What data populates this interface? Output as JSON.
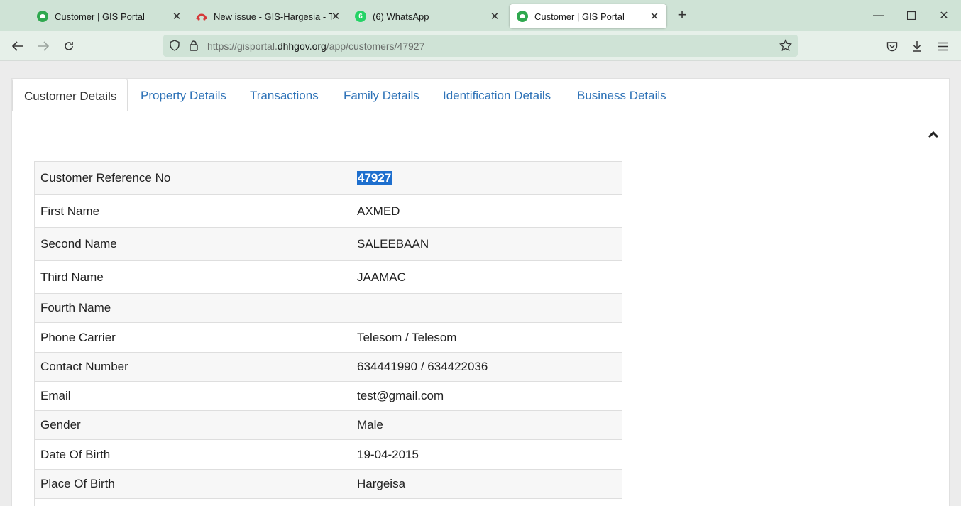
{
  "browser": {
    "tabs": [
      {
        "title": "Customer | GIS Portal",
        "icon": "gis-portal-icon"
      },
      {
        "title": "New issue - GIS-Hargesia - Team",
        "icon": "team-icon"
      },
      {
        "title": "(6) WhatsApp",
        "icon": "whatsapp-icon",
        "badge": "6"
      },
      {
        "title": "Customer | GIS Portal",
        "icon": "gis-portal-icon",
        "active": true
      }
    ],
    "url_prefix": "https://gisportal.",
    "url_host": "dhhgov.org",
    "url_path": "/app/customers/47927"
  },
  "page": {
    "tabs": [
      "Customer Details",
      "Property Details",
      "Transactions",
      "Family Details",
      "Identification Details",
      "Business Details"
    ],
    "details": [
      {
        "label": "Customer Reference No",
        "value": "47927",
        "selected": true
      },
      {
        "label": "First Name",
        "value": "AXMED"
      },
      {
        "label": "Second Name",
        "value": "SALEEBAAN"
      },
      {
        "label": "Third Name",
        "value": "JAAMAC"
      },
      {
        "label": "Fourth Name",
        "value": ""
      },
      {
        "label": "Phone Carrier",
        "value": "Telesom / Telesom"
      },
      {
        "label": "Contact Number",
        "value": "634441990 / 634422036"
      },
      {
        "label": "Email",
        "value": "test@gmail.com"
      },
      {
        "label": "Gender",
        "value": "Male"
      },
      {
        "label": "Date Of Birth",
        "value": "19-04-2015"
      },
      {
        "label": "Place Of Birth",
        "value": "Hargeisa"
      },
      {
        "label": "",
        "value": ""
      }
    ]
  },
  "colors": {
    "link": "#2d72b7",
    "selection": "#1e6fce",
    "tabbar": "#cfe3d6"
  }
}
